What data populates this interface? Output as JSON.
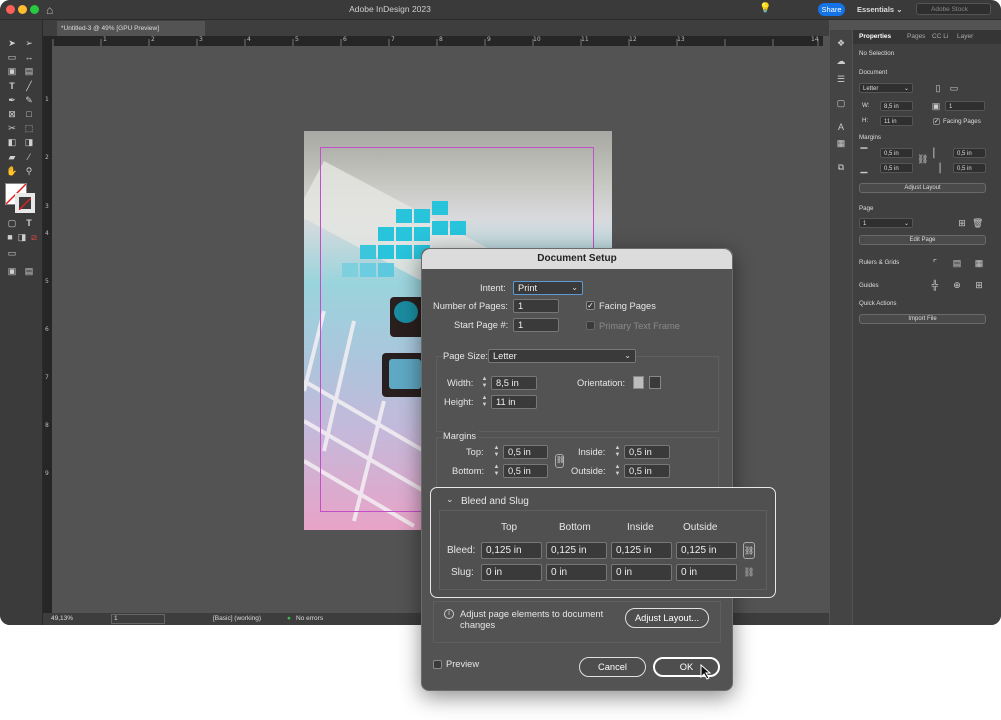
{
  "app": {
    "title": "Adobe InDesign 2023",
    "share_label": "Share",
    "workspace": "Essentials",
    "search_placeholder": "Adobe Stock",
    "doc_tab": "*Untitled-3 @ 49% [GPU Preview]"
  },
  "rulers": {
    "h_ticks": [
      "1",
      "2",
      "3",
      "4",
      "5",
      "6",
      "7",
      "8",
      "9",
      "10",
      "11",
      "12",
      "13",
      "14"
    ],
    "v_ticks": [
      "1",
      "2",
      "3",
      "4",
      "5",
      "6",
      "7",
      "8",
      "9"
    ]
  },
  "statusbar": {
    "zoom": "49,13%",
    "page": "1",
    "style": "[Basic] (working)",
    "errors": "No errors"
  },
  "panel": {
    "tabs": [
      "Properties",
      "Pages",
      "CC Li",
      "Layer"
    ],
    "no_selection": "No Selection",
    "document_heading": "Document",
    "page_size": "Letter",
    "w_label": "W:",
    "w_value": "8,5 in",
    "h_label": "H:",
    "h_value": "11 in",
    "pages_value": "1",
    "facing_pages": "Facing Pages",
    "margins_heading": "Margins",
    "margin_values": [
      "0,5 in",
      "0,5 in",
      "0,5 in",
      "0,5 in"
    ],
    "adjust_layout": "Adjust Layout",
    "page_heading": "Page",
    "page_value": "1",
    "edit_page": "Edit Page",
    "rulers_grids": "Rulers & Grids",
    "guides": "Guides",
    "quick_actions": "Quick Actions",
    "import_file": "Import File"
  },
  "dialog": {
    "title": "Document Setup",
    "intent_label": "Intent:",
    "intent_value": "Print",
    "num_pages_label": "Number of Pages:",
    "num_pages_value": "1",
    "start_page_label": "Start Page #:",
    "start_page_value": "1",
    "facing_pages_label": "Facing Pages",
    "facing_pages_checked": true,
    "primary_text_frame_label": "Primary Text Frame",
    "page_size_label": "Page Size:",
    "page_size_value": "Letter",
    "width_label": "Width:",
    "width_value": "8,5 in",
    "height_label": "Height:",
    "height_value": "11 in",
    "orientation_label": "Orientation:",
    "margins_heading": "Margins",
    "top_label": "Top:",
    "top_value": "0,5 in",
    "bottom_label": "Bottom:",
    "bottom_value": "0,5 in",
    "inside_label": "Inside:",
    "inside_value": "0,5 in",
    "outside_label": "Outside:",
    "outside_value": "0,5 in",
    "bleed_slug": {
      "heading": "Bleed and Slug",
      "columns": [
        "Top",
        "Bottom",
        "Inside",
        "Outside"
      ],
      "bleed_label": "Bleed:",
      "bleed_values": [
        "0,125 in",
        "0,125 in",
        "0,125 in",
        "0,125 in"
      ],
      "slug_label": "Slug:",
      "slug_values": [
        "0 in",
        "0 in",
        "0 in",
        "0 in"
      ]
    },
    "adjust_text": "Adjust page elements to document changes",
    "adjust_button": "Adjust Layout...",
    "preview_label": "Preview",
    "cancel_label": "Cancel",
    "ok_label": "OK"
  }
}
